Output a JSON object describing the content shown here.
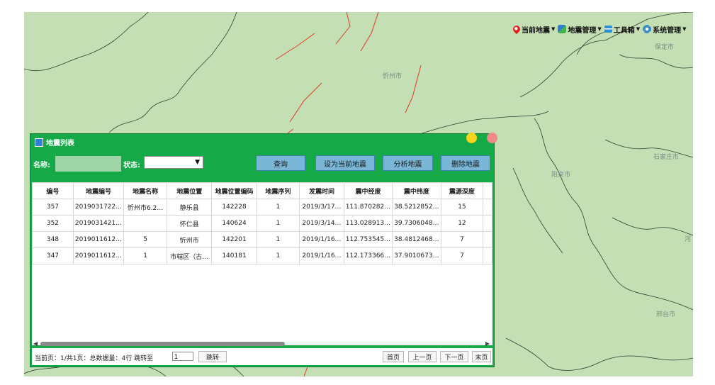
{
  "menu": {
    "items": [
      {
        "label": "当前地震",
        "icon": "location-pin-icon"
      },
      {
        "label": "地震管理",
        "icon": "globe-icon"
      },
      {
        "label": "工具箱",
        "icon": "toolbox-icon"
      },
      {
        "label": "系统管理",
        "icon": "gear-icon"
      }
    ]
  },
  "map": {
    "cities": [
      "忻州市",
      "保定市",
      "石家庄市",
      "阳泉市",
      "邢台市",
      "河"
    ]
  },
  "panel": {
    "title": "地震列表",
    "name_label": "名称:",
    "name_value": "",
    "status_label": "状态:",
    "status_value": "",
    "buttons": {
      "query": "查询",
      "set_current": "设为当前地震",
      "analyze": "分析地震",
      "delete": "删除地震"
    },
    "columns": [
      "编号",
      "地震编号",
      "地震名称",
      "地震位置",
      "地震位置编码",
      "地震序列",
      "发震时间",
      "震中经度",
      "震中纬度",
      "震源深度"
    ],
    "rows": [
      [
        "357",
        "2019031722…",
        "忻州市6.2…",
        "静乐县",
        "142228",
        "1",
        "2019/3/17…",
        "111.870282…",
        "38.5212852…",
        "15"
      ],
      [
        "352",
        "2019031421…",
        "",
        "怀仁县",
        "140624",
        "1",
        "2019/3/14…",
        "113.028913…",
        "39.7306048…",
        "12"
      ],
      [
        "348",
        "2019011612…",
        "5",
        "忻州市",
        "142201",
        "1",
        "2019/1/16…",
        "112.753545…",
        "38.4812468…",
        "7"
      ],
      [
        "347",
        "2019011612…",
        "1",
        "市辖区（古…",
        "140181",
        "1",
        "2019/1/16…",
        "112.173366…",
        "37.9010673…",
        "7"
      ]
    ],
    "pager": {
      "info": "当前页：1/共1页：总数据量：4行",
      "jump_label": "跳转至",
      "jump_value": "1",
      "jump_button": "跳转",
      "first": "首页",
      "prev": "上一页",
      "next": "下一页",
      "last": "末页"
    }
  },
  "colors": {
    "panel_green": "#16a948",
    "map_green": "#c4dfb3",
    "fault_red": "#e03a22",
    "button_blue": "#7ab6d6",
    "minimize_dot": "#f6d51f",
    "close_dot": "#f08a8a"
  }
}
